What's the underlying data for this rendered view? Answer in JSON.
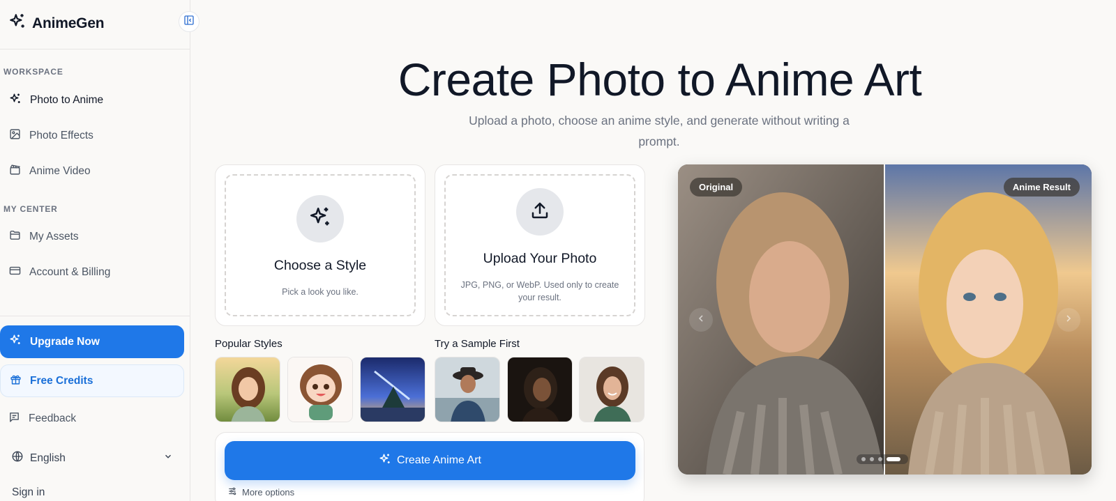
{
  "sidebar": {
    "brand": "AnimeGen",
    "sections": {
      "workspace": "WORKSPACE",
      "my_center": "MY CENTER"
    },
    "items": [
      {
        "label": "Photo to Anime",
        "icon": "sparkles-icon"
      },
      {
        "label": "Photo Effects",
        "icon": "image-icon"
      },
      {
        "label": "Anime Video",
        "icon": "clapperboard-icon"
      },
      {
        "label": "My Assets",
        "icon": "folder-icon"
      },
      {
        "label": "Account & Billing",
        "icon": "credit-card-icon"
      }
    ],
    "upgrade": "Upgrade Now",
    "free_credits": "Free Credits",
    "feedback": "Feedback",
    "language": "English",
    "sign_in": "Sign in"
  },
  "hero": {
    "title": "Create Photo to Anime Art",
    "subtitle": "Upload a photo, choose an anime style, and generate without writing a prompt."
  },
  "cards": {
    "style": {
      "title": "Choose a Style",
      "desc": "Pick a look you like."
    },
    "upload": {
      "title": "Upload Your Photo",
      "desc": "JPG, PNG, or WebP. Used only to create your result."
    }
  },
  "rows": {
    "popular_styles": "Popular Styles",
    "try_sample": "Try a Sample First"
  },
  "actions": {
    "create": "Create Anime Art",
    "more_options": "More options"
  },
  "preview": {
    "original_label": "Original",
    "result_label": "Anime Result",
    "slides": 4,
    "active_slide": 4
  },
  "colors": {
    "accent": "#1f78e8",
    "background": "#faf9f7"
  }
}
